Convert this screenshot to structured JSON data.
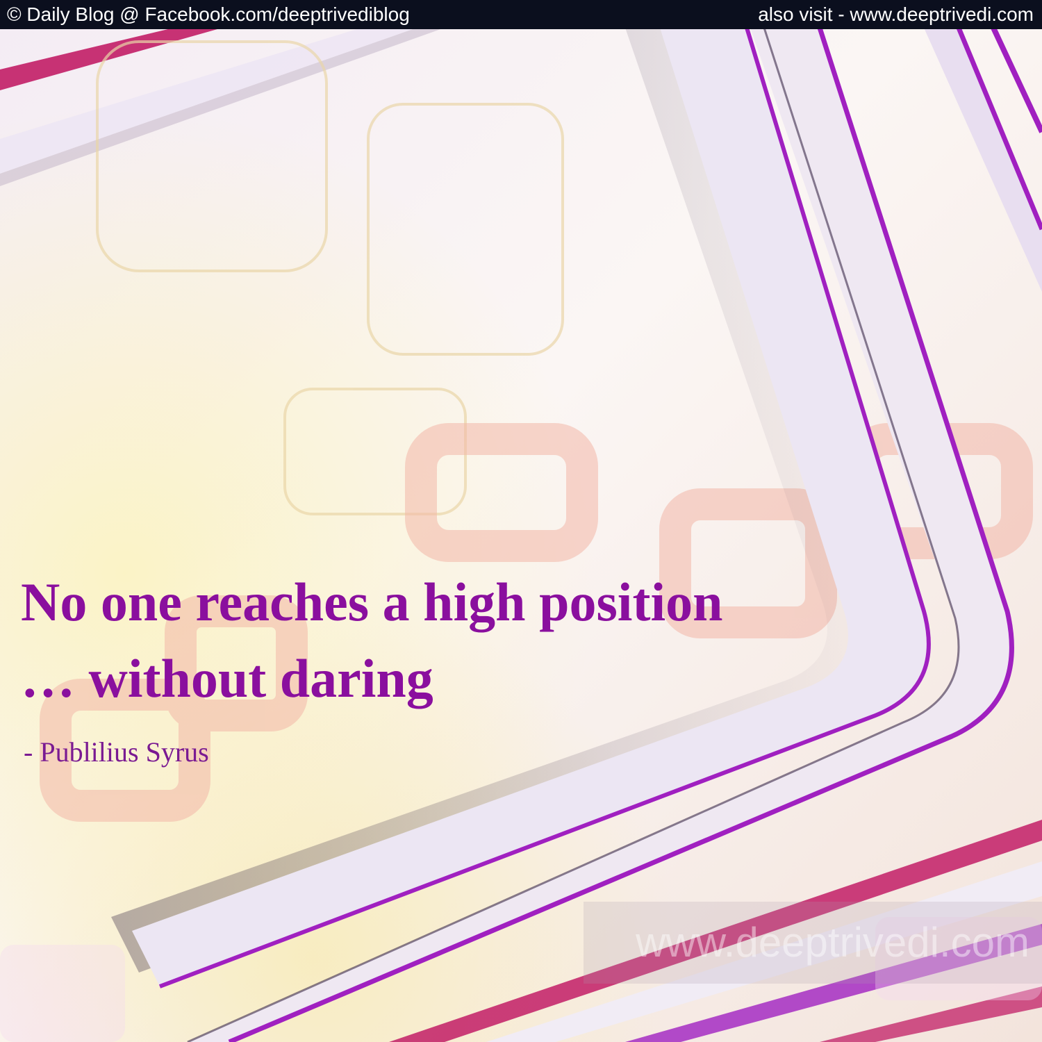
{
  "header": {
    "left_text": "© Daily Blog @ Facebook.com/deeptrivediblog",
    "right_text": "also visit - www.deeptrivedi.com"
  },
  "quote": {
    "line1": "No one reaches a high position",
    "line2": "… without daring",
    "author": "- Publilius Syrus"
  },
  "watermark": {
    "text": "www.deeptrivedi.com"
  },
  "colors": {
    "quote_text": "#8a0f9e",
    "author_text": "#7a1a92",
    "header_bar": "#0b0f1e",
    "header_text": "#ffffff",
    "accent_purple": "#a020c0",
    "accent_magenta": "#c0206a"
  }
}
